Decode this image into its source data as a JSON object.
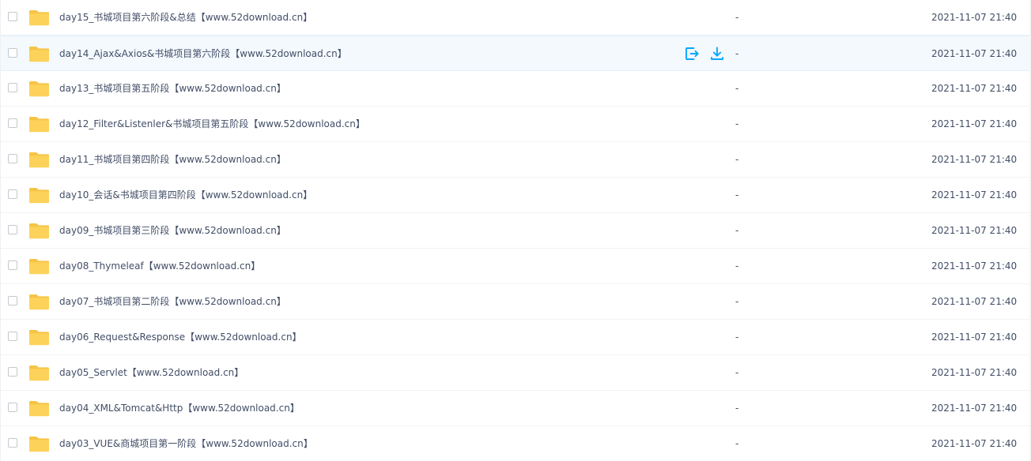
{
  "colors": {
    "folder": "#fcd25a",
    "folder_back": "#f6c445",
    "action_icon": "#06a7ff",
    "text": "#424e67",
    "hover_row": "#f3f9fd"
  },
  "hover_actions": {
    "share_icon": "share-icon",
    "download_icon": "download-icon"
  },
  "files": [
    {
      "name": "day15_书城项目第六阶段&总结【www.52download.cn】",
      "size": "-",
      "modified": "2021-11-07 21:40",
      "hover": false
    },
    {
      "name": "day14_Ajax&Axios&书城项目第六阶段【www.52download.cn】",
      "size": "-",
      "modified": "2021-11-07 21:40",
      "hover": true
    },
    {
      "name": "day13_书城项目第五阶段【www.52download.cn】",
      "size": "-",
      "modified": "2021-11-07 21:40",
      "hover": false
    },
    {
      "name": "day12_Filter&Listenler&书城项目第五阶段【www.52download.cn】",
      "size": "-",
      "modified": "2021-11-07 21:40",
      "hover": false
    },
    {
      "name": "day11_书城项目第四阶段【www.52download.cn】",
      "size": "-",
      "modified": "2021-11-07 21:40",
      "hover": false
    },
    {
      "name": "day10_会话&书城项目第四阶段【www.52download.cn】",
      "size": "-",
      "modified": "2021-11-07 21:40",
      "hover": false
    },
    {
      "name": "day09_书城项目第三阶段【www.52download.cn】",
      "size": "-",
      "modified": "2021-11-07 21:40",
      "hover": false
    },
    {
      "name": "day08_Thymeleaf【www.52download.cn】",
      "size": "-",
      "modified": "2021-11-07 21:40",
      "hover": false
    },
    {
      "name": "day07_书城项目第二阶段【www.52download.cn】",
      "size": "-",
      "modified": "2021-11-07 21:40",
      "hover": false
    },
    {
      "name": "day06_Request&Response【www.52download.cn】",
      "size": "-",
      "modified": "2021-11-07 21:40",
      "hover": false
    },
    {
      "name": "day05_Servlet【www.52download.cn】",
      "size": "-",
      "modified": "2021-11-07 21:40",
      "hover": false
    },
    {
      "name": "day04_XML&Tomcat&Http【www.52download.cn】",
      "size": "-",
      "modified": "2021-11-07 21:40",
      "hover": false
    },
    {
      "name": "day03_VUE&商城项目第一阶段【www.52download.cn】",
      "size": "-",
      "modified": "2021-11-07 21:40",
      "hover": false
    }
  ]
}
